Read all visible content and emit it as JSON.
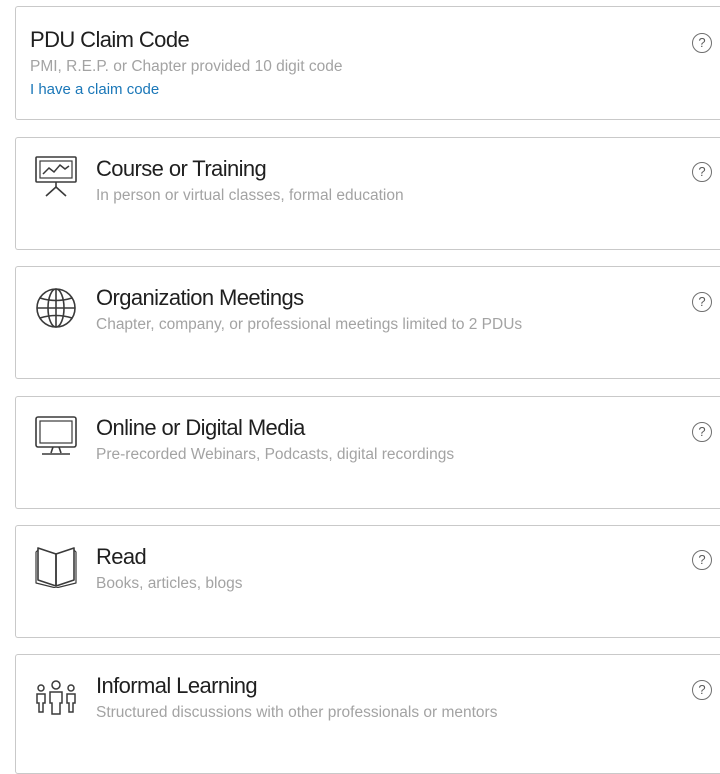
{
  "help_glyph": "?",
  "cards": [
    {
      "icon": "none",
      "title": "PDU Claim Code",
      "description": "PMI, R.E.P. or Chapter provided 10 digit code",
      "link": "I have a claim code"
    },
    {
      "icon": "presentation-easel-icon",
      "title": "Course or Training",
      "description": "In person or virtual classes, formal education"
    },
    {
      "icon": "globe-icon",
      "title": "Organization Meetings",
      "description": "Chapter, company, or professional meetings limited to 2 PDUs"
    },
    {
      "icon": "monitor-icon",
      "title": "Online or Digital Media",
      "description": "Pre-recorded Webinars, Podcasts, digital recordings"
    },
    {
      "icon": "open-book-icon",
      "title": "Read",
      "description": "Books, articles, blogs"
    },
    {
      "icon": "people-group-icon",
      "title": "Informal Learning",
      "description": "Structured discussions with other professionals or mentors"
    }
  ]
}
